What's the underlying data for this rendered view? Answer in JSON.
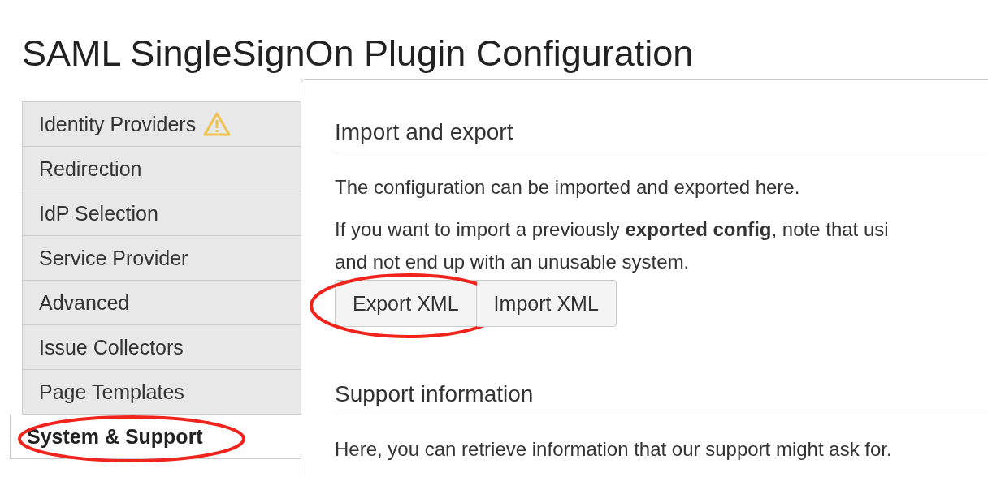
{
  "page": {
    "title": "SAML SingleSignOn Plugin Configuration"
  },
  "sidebar": {
    "items": [
      {
        "label": "Identity Providers",
        "selected": false,
        "warning": true,
        "circled": false
      },
      {
        "label": "Redirection",
        "selected": false,
        "warning": false,
        "circled": false
      },
      {
        "label": "IdP Selection",
        "selected": false,
        "warning": false,
        "circled": false
      },
      {
        "label": "Service Provider",
        "selected": false,
        "warning": false,
        "circled": false
      },
      {
        "label": "Advanced",
        "selected": false,
        "warning": false,
        "circled": false
      },
      {
        "label": "Issue Collectors",
        "selected": false,
        "warning": false,
        "circled": false
      },
      {
        "label": "Page Templates",
        "selected": false,
        "warning": false,
        "circled": false
      },
      {
        "label": "System & Support",
        "selected": true,
        "warning": false,
        "circled": true
      }
    ]
  },
  "sections": [
    {
      "heading": "Import and export",
      "paragraphs": [
        "The configuration can be imported and exported here.",
        "If you want to import a previously **exported config**, note that usi\nand not end up with an unusable system."
      ],
      "buttons": [
        {
          "label": "Export XML",
          "circled": true
        },
        {
          "label": "Import XML",
          "circled": false
        }
      ]
    },
    {
      "heading": "Support information",
      "paragraphs": [
        "Here, you can retrieve information that our support might ask for."
      ]
    }
  ]
}
